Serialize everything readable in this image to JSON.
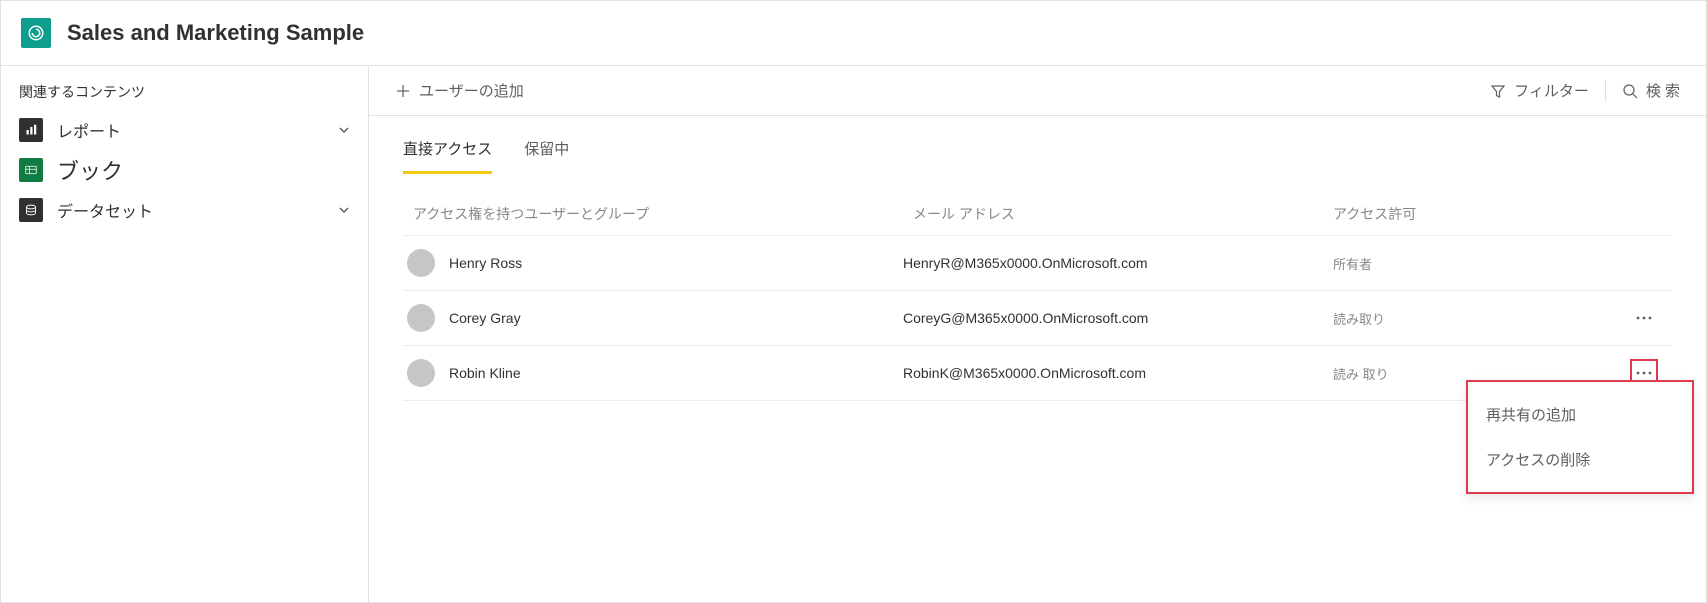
{
  "header": {
    "title": "Sales and Marketing Sample"
  },
  "sidebar": {
    "heading": "関連するコンテンツ",
    "items": [
      {
        "label": "レポート",
        "icon": "bar-chart-icon",
        "active": false,
        "expandable": true
      },
      {
        "label": "ブック",
        "icon": "workbook-icon",
        "active": true,
        "expandable": false
      },
      {
        "label": "データセット",
        "icon": "dataset-icon",
        "active": false,
        "expandable": true
      }
    ]
  },
  "toolbar": {
    "add_user_label": "ユーザーの追加",
    "filter_label": "フィルター",
    "search_label": "検 索"
  },
  "tabs": {
    "direct_access": "直接アクセス",
    "pending": "保留中",
    "active": "direct_access"
  },
  "table": {
    "columns": {
      "user": "アクセス権を持つユーザーとグループ",
      "email": "メール アドレス",
      "permission": "アクセス許可"
    },
    "rows": [
      {
        "name": "Henry Ross",
        "email": "HenryR@M365x0000.OnMicrosoft.com",
        "permission": "所有者",
        "has_more": false
      },
      {
        "name": "Corey Gray",
        "email": "CoreyG@M365x0000.OnMicrosoft.com",
        "permission": "読み取り",
        "has_more": true,
        "more_open": false
      },
      {
        "name": "Robin Kline",
        "email": "RobinK@M365x0000.OnMicrosoft.com",
        "permission": "読み 取り",
        "has_more": true,
        "more_open": true
      }
    ]
  },
  "context_menu": {
    "items": [
      {
        "label": "再共有の追加"
      },
      {
        "label": "アクセスの削除"
      }
    ]
  }
}
